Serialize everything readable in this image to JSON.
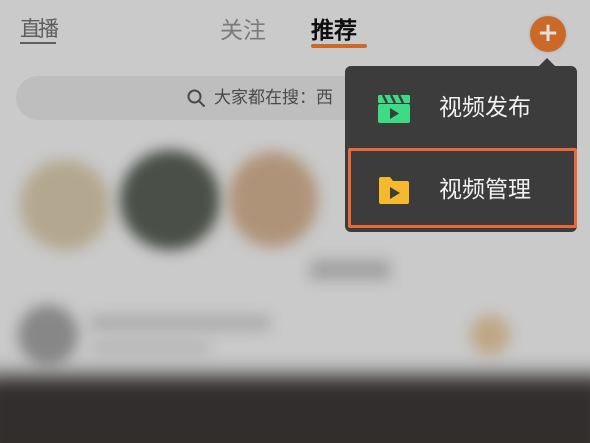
{
  "topbar": {
    "live_label": "直播",
    "tabs": [
      {
        "label": "关注",
        "active": false
      },
      {
        "label": "推荐",
        "active": true
      }
    ],
    "add_label": "+"
  },
  "search": {
    "text": "大家都在搜：西"
  },
  "menu": {
    "items": [
      {
        "label": "视频发布",
        "icon": "video-clapper-icon",
        "icon_color": "#3ddc84"
      },
      {
        "label": "视频管理",
        "icon": "video-folder-icon",
        "icon_color": "#f5b92e",
        "highlighted": true
      }
    ]
  },
  "colors": {
    "accent": "#e8782e",
    "highlight_border": "#e8693a",
    "menu_bg": "#3c3c3c"
  }
}
